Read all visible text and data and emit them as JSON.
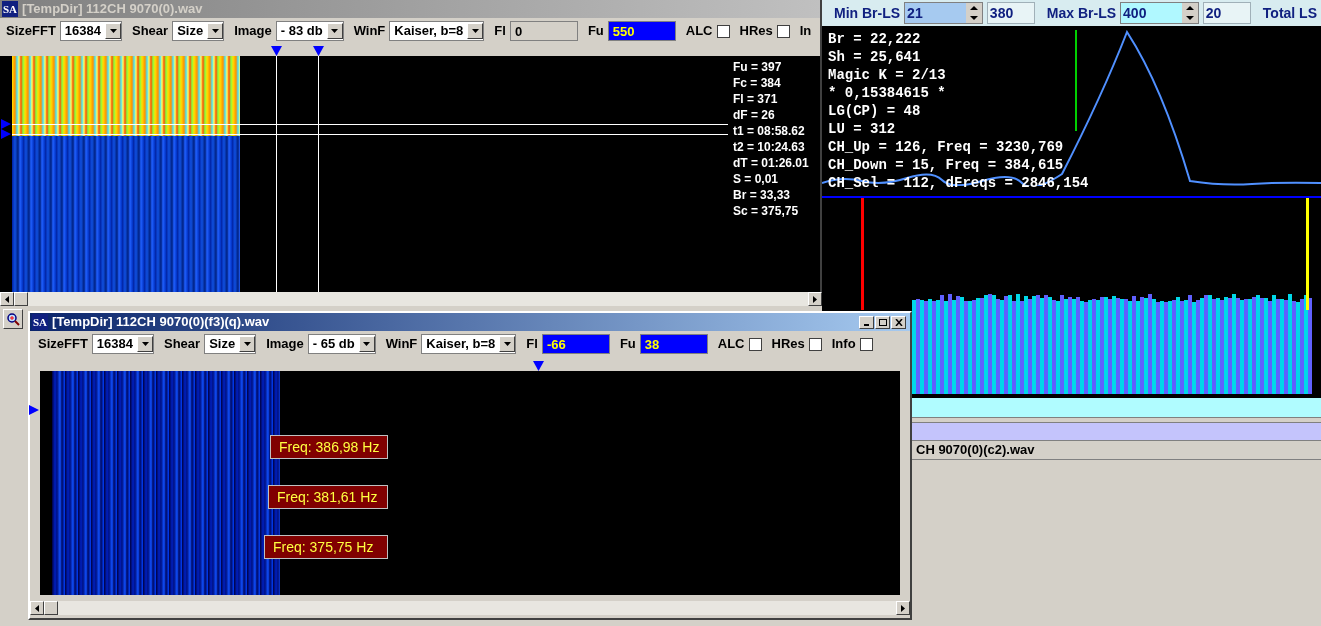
{
  "main_window": {
    "icon_text": "SA",
    "title": "[TempDir] 112CH 9070(0).wav",
    "active": false,
    "toolbar": [
      {
        "kind": "dropdown",
        "label": "SizeFFT",
        "value": "16384"
      },
      {
        "kind": "dropdown",
        "label": "Shear",
        "value": "Size"
      },
      {
        "kind": "dropdown",
        "label": "Image",
        "value": "- 83 db"
      },
      {
        "kind": "dropdown",
        "label": "WinF",
        "value": "Kaiser, b=8"
      },
      {
        "kind": "field",
        "label": "Fl",
        "value": "0",
        "highlighted": false
      },
      {
        "kind": "field",
        "label": "Fu",
        "value": "550",
        "highlighted": true
      },
      {
        "kind": "checkbox",
        "label": "ALC",
        "checked": false
      },
      {
        "kind": "checkbox",
        "label": "HRes",
        "checked": false
      },
      {
        "kind": "label",
        "label": "In"
      }
    ],
    "readouts": [
      "Fu = 397",
      "Fc = 384",
      "Fl = 371",
      "dF = 26",
      "t1 = 08:58.62",
      "t2 = 10:24.63",
      "dT = 01:26.01",
      "S = 0,01",
      "Br = 33,33",
      "Sc = 375,75"
    ]
  },
  "analysis_panel": {
    "controls": [
      {
        "kind": "label",
        "text": "Min Br-LS"
      },
      {
        "kind": "spin",
        "value": "21",
        "color": "#a6caf0"
      },
      {
        "kind": "field",
        "value": "380"
      },
      {
        "kind": "label",
        "text": "Max Br-LS"
      },
      {
        "kind": "spin",
        "value": "400",
        "color": "#b0f8ff"
      },
      {
        "kind": "field",
        "value": "20"
      },
      {
        "kind": "label",
        "text": "Total LS"
      }
    ],
    "stats": [
      "Br = 22,222",
      "Sh = 25,641",
      "Magic K = 2/13",
      "* 0,15384615 *",
      "LG(CP) = 48",
      "LU = 312",
      "CH_Up = 126, Freq = 3230,769",
      "CH_Down = 15, Freq = 384,615",
      "CH_Sel = 112, dFreqs = 2846,154"
    ],
    "file_label": "CH 9070(0)(c2).wav"
  },
  "sub_window": {
    "icon_text": "SA",
    "title": "[TempDir] 112CH 9070(0)(f3)(q).wav",
    "active": true,
    "toolbar": [
      {
        "kind": "dropdown",
        "label": "SizeFFT",
        "value": "16384"
      },
      {
        "kind": "dropdown",
        "label": "Shear",
        "value": "Size"
      },
      {
        "kind": "dropdown",
        "label": "Image",
        "value": "- 65 db"
      },
      {
        "kind": "dropdown",
        "label": "WinF",
        "value": "Kaiser, b=8"
      },
      {
        "kind": "field",
        "label": "Fl",
        "value": "-66",
        "highlighted": true
      },
      {
        "kind": "field",
        "label": "Fu",
        "value": "38",
        "highlighted": true
      },
      {
        "kind": "checkbox",
        "label": "ALC",
        "checked": false
      },
      {
        "kind": "checkbox",
        "label": "HRes",
        "checked": false
      },
      {
        "kind": "checkbox",
        "label": "Info",
        "checked": false
      }
    ],
    "freq_labels": [
      "Freq: 386,98 Hz",
      "Freq: 381,61 Hz",
      "Freq: 375,75 Hz"
    ]
  }
}
